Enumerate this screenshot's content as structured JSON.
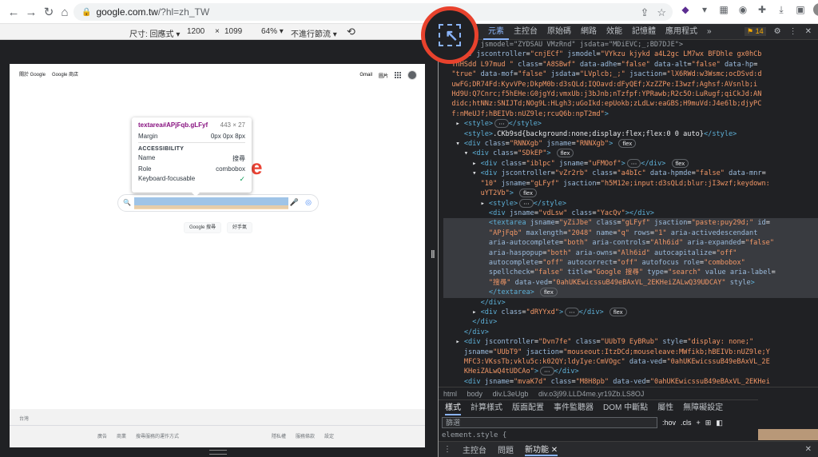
{
  "browser": {
    "url_host": "google.com.tw",
    "url_path": "/?hl=zh_TW"
  },
  "device_toolbar": {
    "dimensions_label": "尺寸: 回應式 ▾",
    "width": "1200",
    "times": "×",
    "height": "1099",
    "zoom": "64% ▾",
    "throttle": "不進行節流 ▾"
  },
  "google_page": {
    "top_left_links": [
      "關於 Google",
      "Google 商店"
    ],
    "top_right_links": [
      "Gmail",
      "圖片"
    ],
    "logo_fragment": "e",
    "search_button": "Google 搜尋",
    "lucky_button": "好手氣",
    "country": "台灣",
    "footer_left": [
      "廣告",
      "商業",
      "搜尋服務的運作方式"
    ],
    "footer_right": [
      "隱私權",
      "服務條款",
      "設定"
    ]
  },
  "tooltip": {
    "selector": "textarea#APjFqb.gLFyf",
    "size": "443 × 27",
    "margin_label": "Margin",
    "margin_value": "0px 0px 8px",
    "section": "ACCESSIBILITY",
    "name_label": "Name",
    "name_value": "搜尋",
    "role_label": "Role",
    "role_value": "combobox",
    "focus_label": "Keyboard-focusable"
  },
  "devtools": {
    "tabs": [
      "元素",
      "主控台",
      "原始碼",
      "網路",
      "效能",
      "記憶體",
      "應用程式",
      "»"
    ],
    "issues_count": "14",
    "breadcrumbs": [
      "html",
      "body",
      "div.L3eUgb",
      "div.o3j99.LLD4me.yr19Zb.LS8OJ"
    ],
    "style_tabs": [
      "樣式",
      "計算樣式",
      "版面配置",
      "事件監聽器",
      "DOM 中斷點",
      "屬性",
      "無障礙設定"
    ],
    "filter_placeholder": "篩選",
    "hov": ":hov",
    "cls": ".cls",
    "element_style": "element.style {",
    "drawer_tabs": [
      "主控台",
      "問題",
      "新功能"
    ]
  }
}
